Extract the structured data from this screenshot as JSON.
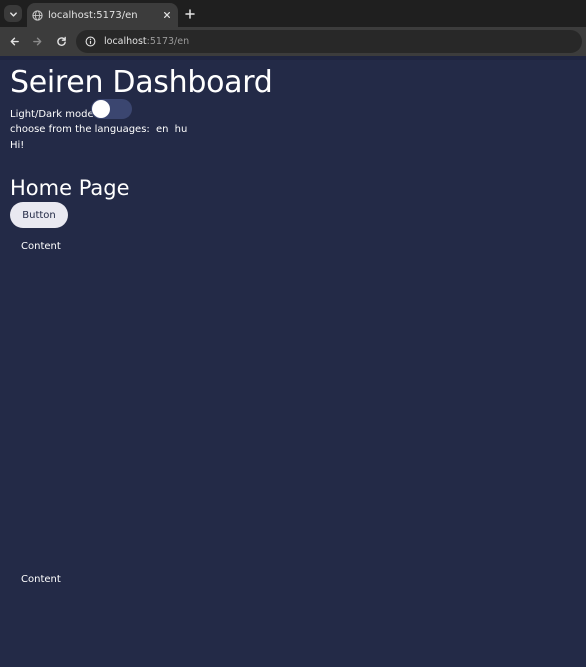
{
  "browser": {
    "tab": {
      "title": "localhost:5173/en",
      "favicon": "globe-icon",
      "close": "close-icon"
    },
    "tab_menu_icon": "chevron-down-icon",
    "new_tab_icon": "plus-icon",
    "nav": {
      "back_icon": "arrow-left-icon",
      "forward_icon": "arrow-right-icon",
      "reload_icon": "reload-icon",
      "site_info_icon": "info-icon"
    },
    "url": {
      "host": "localhost",
      "path": ":5173/en"
    }
  },
  "page": {
    "title": "Seiren Dashboard",
    "mode_label": "Light/Dark mode",
    "toggle_on": false,
    "languages_label": "choose from the languages:",
    "languages": [
      "en",
      "hu"
    ],
    "greeting": "Hi!",
    "subtitle": "Home Page",
    "button_label": "Button",
    "content_top": "Content",
    "content_bottom": "Content"
  },
  "colors": {
    "page_background": "#232a47",
    "toggle_track": "#3b4670",
    "button_background": "#e9e9f1",
    "chrome_tabstrip": "#1f1f1f",
    "chrome_toolbar": "#3c3c3c"
  }
}
